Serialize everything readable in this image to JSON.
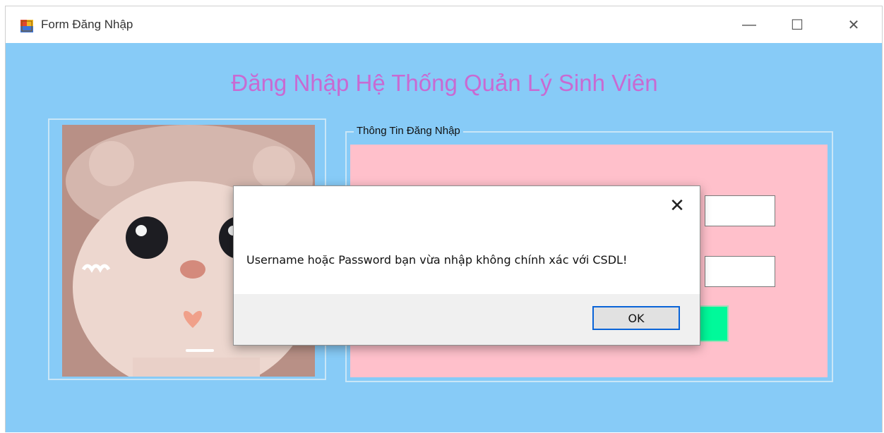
{
  "window": {
    "title": "Form Đăng Nhập",
    "controls": {
      "minimize": "—",
      "maximize": "☐",
      "close": "✕"
    }
  },
  "form": {
    "heading": "Đăng Nhập Hệ Thống Quản Lý Sinh Viên",
    "groupbox_title": "Thông Tin Đăng Nhập"
  },
  "dialog": {
    "message": "Username hoặc Password bạn vừa nhập không chính xác với CSDL!",
    "close_label": "✕",
    "ok_label": "OK"
  },
  "colors": {
    "client_bg": "#87cbf7",
    "heading": "#c86ad2",
    "panel": "#ffc0cb",
    "green_button": "#00f99a",
    "ok_border": "#0a64d8"
  }
}
